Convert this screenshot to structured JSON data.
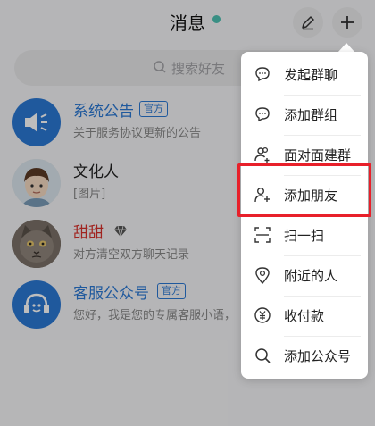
{
  "header": {
    "title": "消息",
    "status_dot_color": "#4dc1b2"
  },
  "search": {
    "placeholder": "搜索好友"
  },
  "chats": [
    {
      "name": "系统公告",
      "badge": "官方",
      "preview": "关于服务协议更新的公告",
      "avatar_icon": "megaphone-icon"
    },
    {
      "name": "文化人",
      "preview": "[图片]",
      "avatar_icon": "person-avatar"
    },
    {
      "name": "甜甜",
      "preview": "对方清空双方聊天记录",
      "avatar_icon": "cat-avatar",
      "name_color": "#d8312c"
    },
    {
      "name": "客服公众号",
      "badge": "官方",
      "preview": "您好，我是您的专属客服小语，",
      "avatar_icon": "headset-icon"
    }
  ],
  "menu": {
    "items": [
      {
        "label": "发起群聊",
        "icon": "chat-bubble-icon"
      },
      {
        "label": "添加群组",
        "icon": "chat-bubble-icon"
      },
      {
        "label": "面对面建群",
        "icon": "group-add-icon"
      },
      {
        "label": "添加朋友",
        "icon": "person-add-icon"
      },
      {
        "label": "扫一扫",
        "icon": "scan-icon"
      },
      {
        "label": "附近的人",
        "icon": "location-pin-icon"
      },
      {
        "label": "收付款",
        "icon": "yuan-coin-icon"
      },
      {
        "label": "添加公众号",
        "icon": "search-icon"
      }
    ]
  },
  "colors": {
    "accent_blue": "#2b78d4",
    "highlight_red": "#e8202a"
  }
}
